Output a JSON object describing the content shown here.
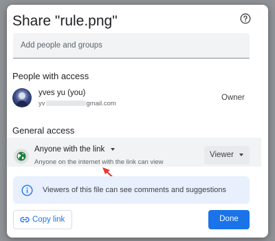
{
  "dialog": {
    "title": "Share \"rule.png\"",
    "help_icon": "help-circle-icon"
  },
  "add_people": {
    "placeholder": "Add people and groups"
  },
  "people_section": {
    "label": "People with access",
    "person": {
      "name": "yves yu (you)",
      "email_prefix": "yv",
      "email_suffix": "gmail.com",
      "role": "Owner"
    }
  },
  "general_access": {
    "label": "General access",
    "scope": "Anyone with the link",
    "description": "Anyone on the internet with the link can view",
    "role": "Viewer",
    "icon": "globe-icon"
  },
  "info_banner": {
    "text": "Viewers of this file can see comments and suggestions",
    "icon": "info-icon"
  },
  "actions": {
    "copy_link": "Copy link",
    "done": "Done"
  },
  "colors": {
    "accent": "#1a73e8",
    "annotation_arrow": "#e53935",
    "globe": "#188038"
  }
}
